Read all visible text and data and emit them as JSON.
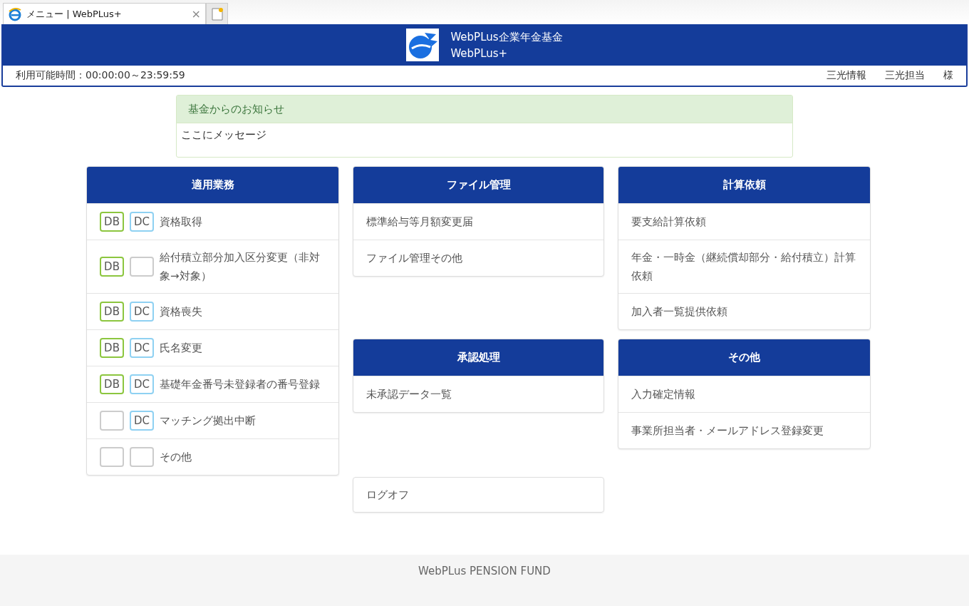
{
  "browser_tab": {
    "title": "メニュー | WebPLus+",
    "close": "×"
  },
  "header": {
    "title": "WebPLus企業年金基金",
    "subtitle": "WebPLus+",
    "hours": "利用可能時間：00:00:00～23:59:59",
    "user": [
      "三光情報",
      "三光担当",
      "様"
    ]
  },
  "notice": {
    "title": "基金からのお知らせ",
    "message": "ここにメッセージ"
  },
  "panels": [
    {
      "title": "適用業務",
      "items": [
        {
          "label": "資格取得",
          "badges": [
            {
              "kind": "db",
              "label": "DB"
            },
            {
              "kind": "dc",
              "label": "DC"
            }
          ]
        },
        {
          "label": "給付積立部分加入区分変更（非対象→対象）",
          "badges": [
            {
              "kind": "db",
              "label": "DB"
            },
            {
              "kind": "empty"
            }
          ]
        },
        {
          "label": "資格喪失",
          "badges": [
            {
              "kind": "db",
              "label": "DB"
            },
            {
              "kind": "dc",
              "label": "DC"
            }
          ]
        },
        {
          "label": "氏名変更",
          "badges": [
            {
              "kind": "db",
              "label": "DB"
            },
            {
              "kind": "dc",
              "label": "DC"
            }
          ]
        },
        {
          "label": "基礎年金番号未登録者の番号登録",
          "badges": [
            {
              "kind": "db",
              "label": "DB"
            },
            {
              "kind": "dc",
              "label": "DC"
            }
          ]
        },
        {
          "label": "マッチング拠出中断",
          "badges": [
            {
              "kind": "empty"
            },
            {
              "kind": "dc",
              "label": "DC"
            }
          ]
        },
        {
          "label": "その他",
          "badges": [
            {
              "kind": "empty"
            },
            {
              "kind": "empty"
            }
          ]
        }
      ]
    },
    {
      "title": "ファイル管理",
      "items": [
        {
          "label": "標準給与等月額変更届"
        },
        {
          "label": "ファイル管理その他"
        }
      ]
    },
    {
      "title": "計算依頼",
      "items": [
        {
          "label": "要支給計算依頼"
        },
        {
          "label": "年金・一時金（継続償却部分・給付積立）計算依頼"
        },
        {
          "label": "加入者一覧提供依頼"
        }
      ]
    },
    {
      "title": "承認処理",
      "items": [
        {
          "label": "未承認データ一覧"
        }
      ]
    },
    {
      "title": "その他",
      "items": [
        {
          "label": "入力確定情報"
        },
        {
          "label": "事業所担当者・メールアドレス登録変更"
        }
      ]
    }
  ],
  "logoff": "ログオフ",
  "footer": "WebPLus PENSION FUND"
}
